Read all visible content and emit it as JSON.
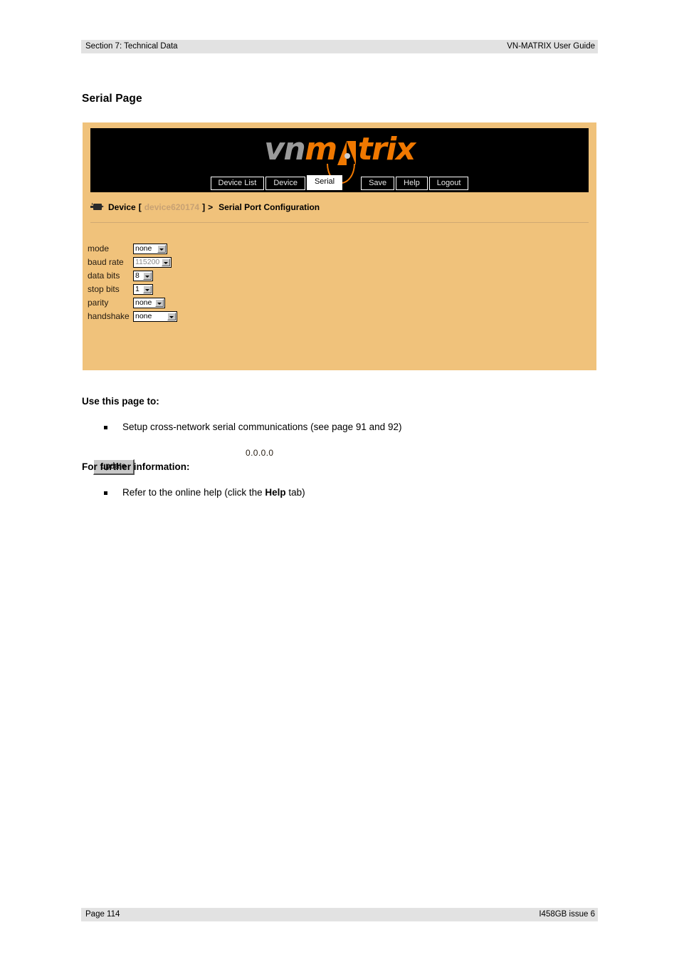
{
  "running_head": {
    "left": "Section 7: Technical Data",
    "right": "VN-MATRIX User Guide"
  },
  "running_foot": {
    "left": "Page 114",
    "right": "I458GB issue 6"
  },
  "page_title": "Serial Page",
  "screenshot": {
    "logo": {
      "part1": "vn",
      "part2": "m",
      "part3": "trix"
    },
    "nav_tabs": [
      {
        "label": "Device List",
        "active": false
      },
      {
        "label": "Device",
        "active": false
      },
      {
        "label": "Serial",
        "active": true
      },
      {
        "label": "Save",
        "active": false
      },
      {
        "label": "Help",
        "active": false
      },
      {
        "label": "Logout",
        "active": false
      }
    ],
    "breadcrumb": {
      "icon": "camera-icon",
      "root": "Device",
      "open_bracket": "[",
      "device_id": "device620174",
      "close_bracket": "]",
      "separator": ">",
      "current": "Serial Port Configuration"
    },
    "form": {
      "fields": [
        {
          "label": "mode",
          "value": "none",
          "width_class": "w-mode",
          "disabled": false
        },
        {
          "label": "baud rate",
          "value": "115200",
          "width_class": "w-baud",
          "disabled": true
        },
        {
          "label": "data bits",
          "value": "8",
          "width_class": "w-databits",
          "disabled": false
        },
        {
          "label": "stop bits",
          "value": "1",
          "width_class": "w-stopbits",
          "disabled": false
        },
        {
          "label": "parity",
          "value": "none",
          "width_class": "w-parity",
          "disabled": false
        },
        {
          "label": "handshake",
          "value": "none",
          "width_class": "w-handshake",
          "disabled": false
        }
      ],
      "status_ip": "0.0.0.0",
      "update_button": "update"
    },
    "colors": {
      "panel_background": "#f0c27b",
      "masthead_background": "#000000",
      "logo_orange": "#f07800",
      "logo_grey": "#9a9a9a",
      "device_id_text": "#c7a173"
    }
  },
  "prose": {
    "use_this_page_heading": "Use this page to:",
    "use_this_page_bullets": [
      "Setup cross-network serial communications (see page 91 and 92)"
    ],
    "further_info_heading": "For further information:",
    "further_info_bullet_pre": "Refer to the online help (click the ",
    "further_info_bullet_bold": "Help",
    "further_info_bullet_post": " tab)"
  }
}
